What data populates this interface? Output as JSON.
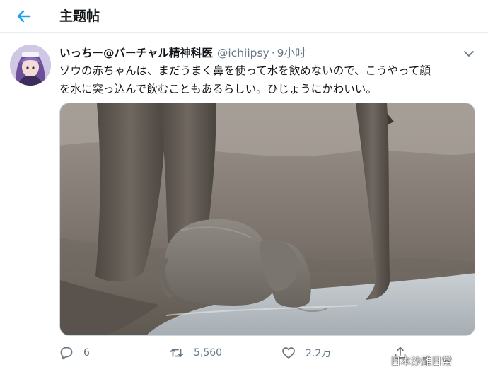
{
  "header": {
    "title": "主题帖"
  },
  "tweet": {
    "display_name": "いっちー@バーチャル精神科医",
    "handle": "@ichiipsy",
    "separator": "·",
    "time": "9小时",
    "text_line1": "ゾウの赤ちゃんは、まだうまく鼻を使って水を飲めないので、こうやって顔",
    "text_line2": "を水に突っ込んで飲むこともあるらしい。ひじょうにかわいい。"
  },
  "actions": {
    "reply_count": "6",
    "retweet_count": "5,560",
    "like_count": "2.2万"
  },
  "watermark": {
    "text": "日本沙雕日常"
  },
  "colors": {
    "accent": "#1da1f2",
    "text_primary": "#14171a",
    "text_secondary": "#657786",
    "divider": "#e6ecf0"
  },
  "icons": [
    "back-arrow-icon",
    "chevron-down-icon",
    "reply-icon",
    "retweet-icon",
    "like-icon",
    "share-icon",
    "weibo-icon"
  ]
}
